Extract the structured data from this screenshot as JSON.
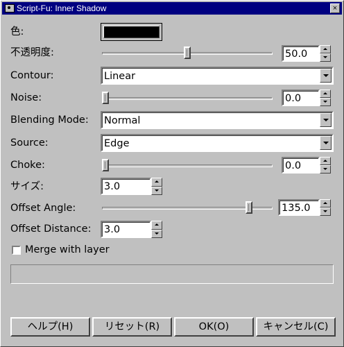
{
  "window": {
    "title": "Script-Fu: Inner Shadow",
    "close_glyph": "×"
  },
  "fields": {
    "color": {
      "label": "色:",
      "value": "#000000"
    },
    "opacity": {
      "label": "不透明度:",
      "value": "50.0",
      "fraction": 0.5
    },
    "contour": {
      "label": "Contour:",
      "value": "Linear"
    },
    "noise": {
      "label": "Noise:",
      "value": "0.0",
      "fraction": 0.0
    },
    "blending_mode": {
      "label": "Blending Mode:",
      "value": "Normal"
    },
    "source": {
      "label": "Source:",
      "value": "Edge"
    },
    "choke": {
      "label": "Choke:",
      "value": "0.0",
      "fraction": 0.0
    },
    "size": {
      "label": "サイズ:",
      "value": "3.0"
    },
    "offset_angle": {
      "label": "Offset Angle:",
      "value": "135.0",
      "fraction": 0.875
    },
    "offset_distance": {
      "label": "Offset Distance:",
      "value": "3.0"
    },
    "merge": {
      "label": "Merge with layer",
      "checked": false
    }
  },
  "buttons": {
    "help": "ヘルプ(H)",
    "reset": "リセット(R)",
    "ok": "OK(O)",
    "cancel": "キャンセル(C)"
  },
  "icons": {
    "title": "gimp-icon",
    "close": "close-icon",
    "dropdown": "chevron-down-icon"
  }
}
